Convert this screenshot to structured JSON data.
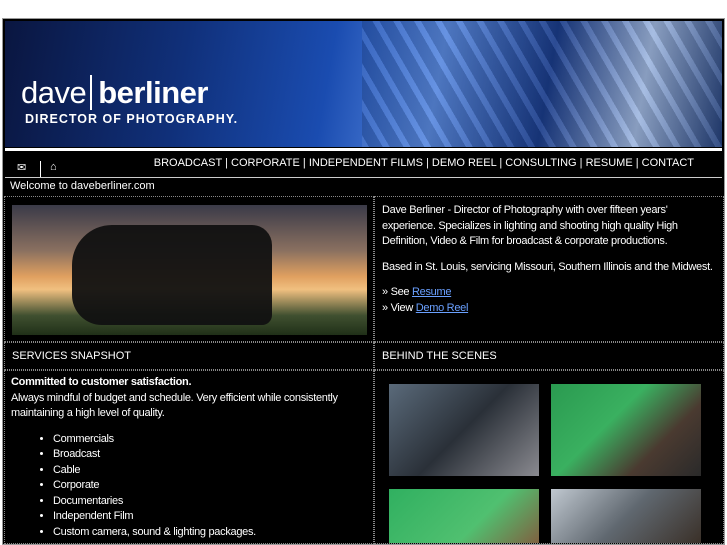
{
  "logo": {
    "name_light": "dave",
    "name_bold": "berliner",
    "subtitle": "DIRECTOR OF PHOTOGRAPHY."
  },
  "nav": {
    "icons": [
      "mail-icon",
      "home-icon"
    ],
    "links": [
      "BROADCAST",
      "CORPORATE",
      "INDEPENDENT FILMS",
      "DEMO REEL",
      "CONSULTING",
      "RESUME",
      "CONTACT"
    ]
  },
  "welcome": "Welcome to daveberliner.com",
  "intro": {
    "p1": "Dave Berliner - Director of Photography with over fifteen years' experience. Specializes in lighting and shooting high quality High Definition, Video & Film for broadcast & corporate productions.",
    "p2": "Based in St. Louis, servicing Missouri, Southern Illinois and the Midwest.",
    "see_prefix": "» See ",
    "see_link": "Resume",
    "view_prefix": "» View ",
    "view_link": "Demo Reel"
  },
  "services": {
    "heading": "SERVICES SNAPSHOT",
    "bold": "Committed to customer satisfaction.",
    "text": "Always mindful of budget and schedule. Very efficient while consistently maintaining a high level of quality.",
    "items": [
      "Commercials",
      "Broadcast",
      "Cable",
      "Corporate",
      "Documentaries",
      "Independent Film",
      "Custom camera, sound & lighting packages."
    ]
  },
  "behind": {
    "heading": "BEHIND THE SCENES"
  }
}
